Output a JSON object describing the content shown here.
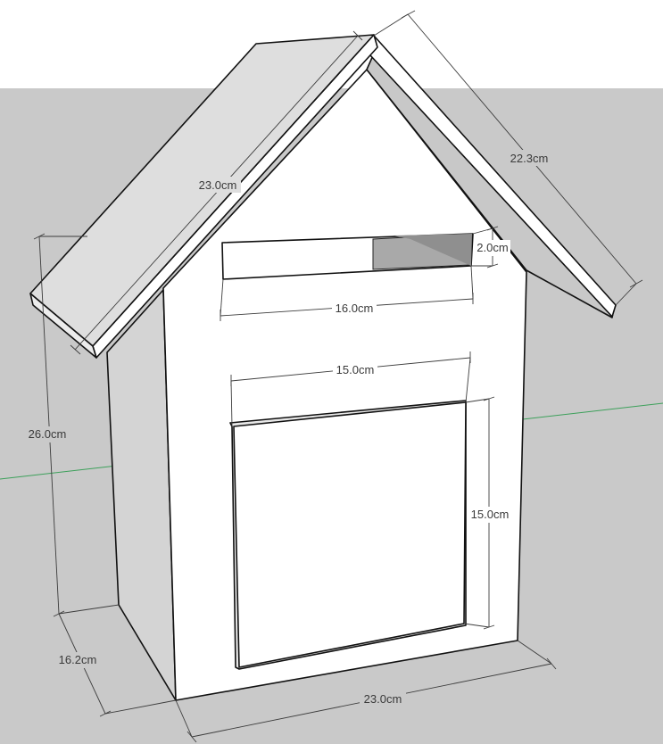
{
  "colors": {
    "sky": "#ffffff",
    "ground": "#c9c9c9",
    "face_front": "#ffffff",
    "face_side": "#d4d4d4",
    "roof_top": "#dedede",
    "inner_dark": "#a9a9a9",
    "axis_green": "#3ca05a",
    "dimension": "#3c3c3c"
  },
  "dimensions": {
    "roof_length": "23.0cm",
    "roof_slope": "22.3cm",
    "slot_height": "2.0cm",
    "slot_width": "16.0cm",
    "door_width": "15.0cm",
    "door_height": "15.0cm",
    "wall_height": "26.0cm",
    "depth": "16.2cm",
    "base_width": "23.0cm"
  }
}
